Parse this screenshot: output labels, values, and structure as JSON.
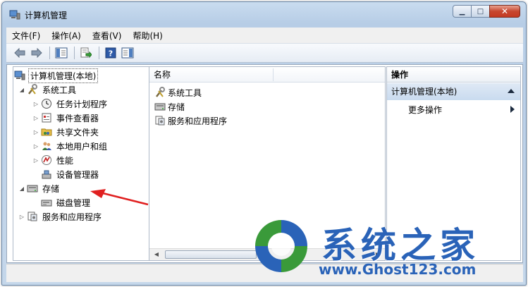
{
  "window": {
    "title": "计算机管理",
    "controls": {
      "minimize": "▁",
      "maximize": "□",
      "close": "✕"
    }
  },
  "menubar": {
    "items": [
      "文件(F)",
      "操作(A)",
      "查看(V)",
      "帮助(H)"
    ]
  },
  "toolbar": {
    "icons": [
      "back-arrow-icon",
      "forward-arrow-icon",
      "show-hide-tree-icon",
      "export-list-icon",
      "help-icon",
      "show-hide-action-pane-icon"
    ]
  },
  "tree": {
    "root": "计算机管理(本地)",
    "system_tools": "系统工具",
    "task_scheduler": "任务计划程序",
    "event_viewer": "事件查看器",
    "shared_folders": "共享文件夹",
    "local_users": "本地用户和组",
    "performance": "性能",
    "device_manager": "设备管理器",
    "storage": "存储",
    "disk_management": "磁盘管理",
    "services_apps": "服务和应用程序"
  },
  "list": {
    "column_name": "名称",
    "items": [
      "系统工具",
      "存储",
      "服务和应用程序"
    ]
  },
  "actions": {
    "header": "操作",
    "section": "计算机管理(本地)",
    "more": "更多操作"
  },
  "watermark": {
    "title": "系统之家",
    "url": "www.Ghost123.com"
  },
  "colors": {
    "title_bar": "#c9dcef",
    "close_button": "#c7472f",
    "watermark_blue": "#2a63b8",
    "arrow_red": "#e02020"
  }
}
